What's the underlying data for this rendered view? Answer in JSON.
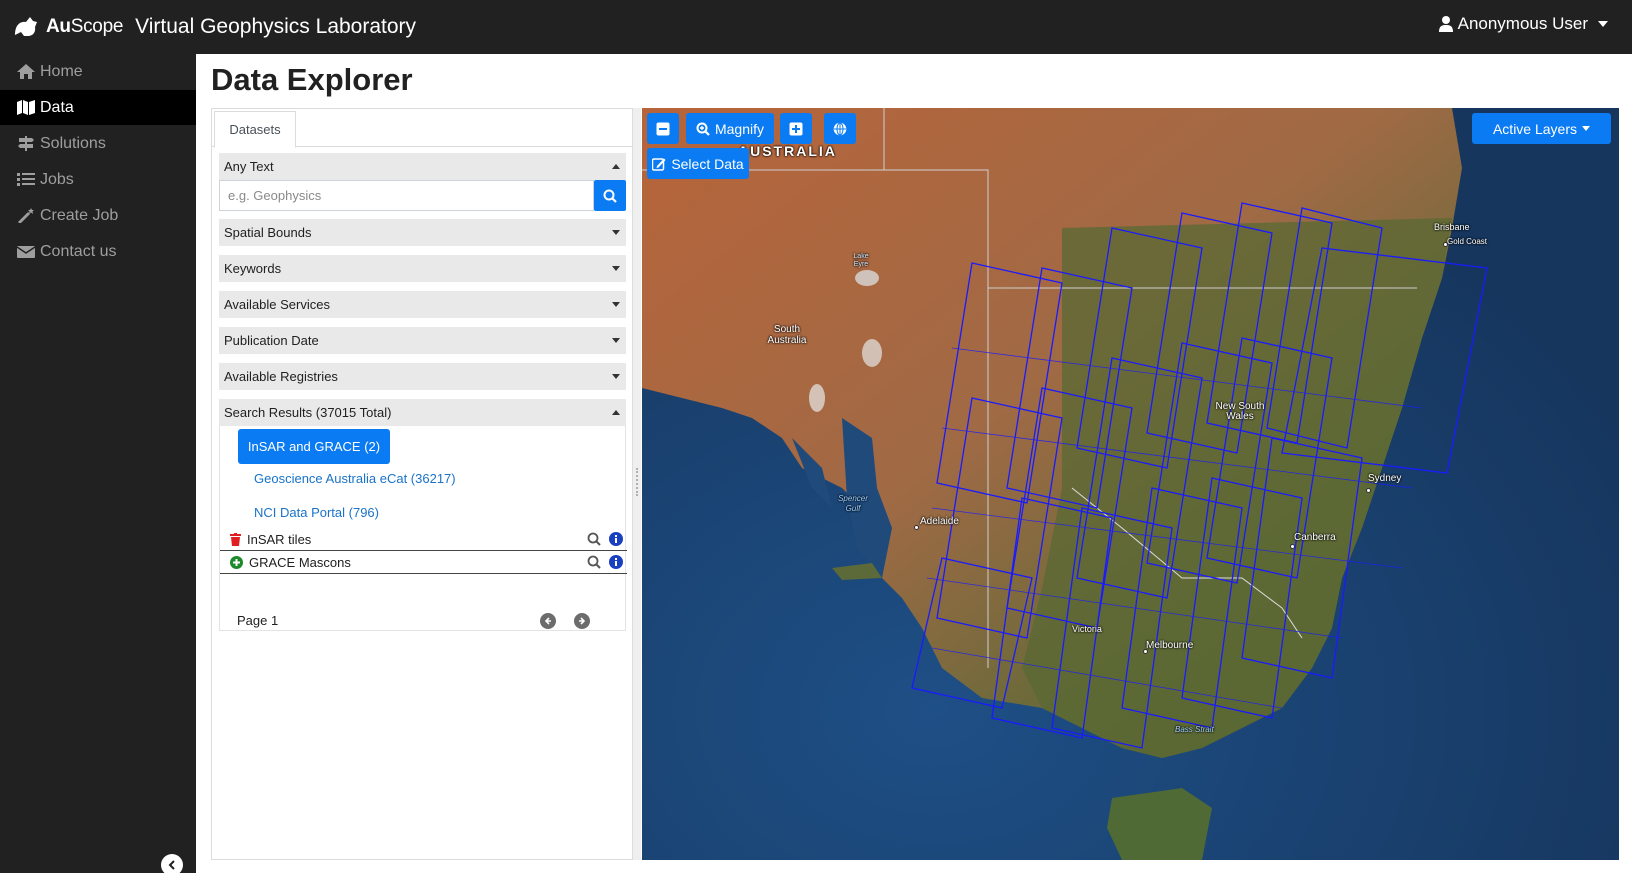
{
  "app": {
    "brand_bold": "Au",
    "brand_rest": "Scope",
    "title": "Virtual Geophysics Laboratory",
    "user": "Anonymous User"
  },
  "sidebar": {
    "items": [
      {
        "label": "Home",
        "icon": "home-icon"
      },
      {
        "label": "Data",
        "icon": "map-icon",
        "active": true
      },
      {
        "label": "Solutions",
        "icon": "signpost-icon"
      },
      {
        "label": "Jobs",
        "icon": "list-icon"
      },
      {
        "label": "Create Job",
        "icon": "magic-wand-icon"
      },
      {
        "label": "Contact us",
        "icon": "envelope-icon"
      }
    ]
  },
  "page": {
    "title": "Data Explorer"
  },
  "panel": {
    "tab": "Datasets",
    "sections": {
      "any_text": "Any Text",
      "spatial_bounds": "Spatial Bounds",
      "keywords": "Keywords",
      "available_services": "Available Services",
      "publication_date": "Publication Date",
      "available_registries": "Available Registries",
      "search_results": "Search Results (37015 Total)"
    },
    "search": {
      "placeholder": "e.g. Geophysics",
      "value": ""
    },
    "registries": [
      {
        "label": "InSAR and GRACE (2)",
        "active": true
      },
      {
        "label": "Geoscience Australia eCat (36217)"
      },
      {
        "label": "NCI Data Portal (796)"
      }
    ],
    "records": [
      {
        "label": "InSAR tiles",
        "status": "remove"
      },
      {
        "label": "GRACE Mascons",
        "status": "add"
      }
    ],
    "pager": {
      "label": "Page 1"
    }
  },
  "map": {
    "buttons": {
      "magnify": "Magnify",
      "select_data": "Select Data",
      "active_layers": "Active Layers"
    },
    "labels": {
      "australia": "AUSTRALIA",
      "lake_eyre": "Lake Eyre",
      "south_australia": "South Australia",
      "spencer_gulf": "Spencer Gulf",
      "adelaide": "Adelaide",
      "nsw": "New South Wales",
      "sydney": "Sydney",
      "canberra": "Canberra",
      "victoria": "Victoria",
      "melbourne": "Melbourne",
      "bass_strait": "Bass Strait",
      "brisbane": "Brisbane",
      "gold_coast": "Gold Coast"
    },
    "colors": {
      "tile_outline": "#1a1aff",
      "button": "#0a7bf2"
    }
  }
}
